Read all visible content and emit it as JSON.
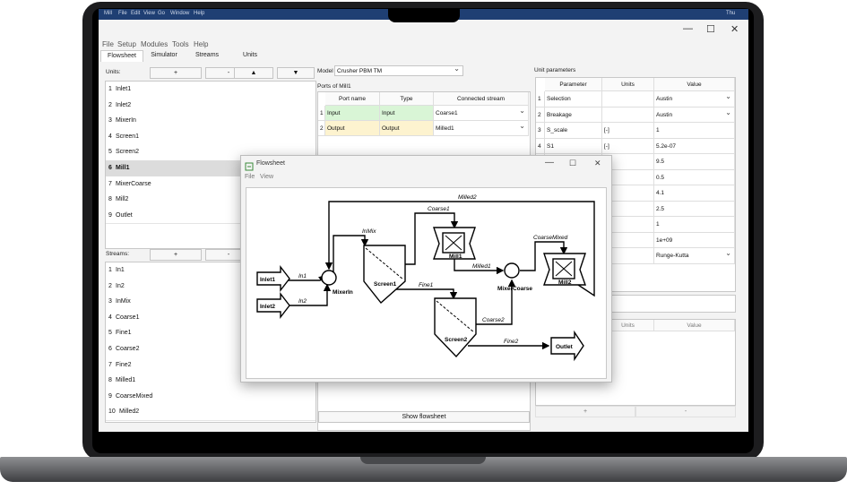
{
  "os_menubar": [
    "Mill",
    "File",
    "Edit",
    "View",
    "Go",
    "Window",
    "Help"
  ],
  "os_status": "Thu",
  "window_controls": {
    "minimize": "—",
    "maximize": "☐",
    "close": "✕"
  },
  "menu": [
    "File",
    "Setup",
    "Modules",
    "Tools",
    "Help"
  ],
  "tabs": [
    "Flowsheet",
    "Simulator",
    "Streams",
    "Units"
  ],
  "units_panel": {
    "label": "Units:",
    "buttons": [
      "+",
      "-",
      "▲",
      "▼"
    ],
    "items": [
      "Inlet1",
      "Inlet2",
      "MixerIn",
      "Screen1",
      "Screen2",
      "Mill1",
      "MixerCoarse",
      "Mill2",
      "Outlet"
    ],
    "selected": 5
  },
  "streams_panel": {
    "label": "Streams:",
    "buttons": [
      "+",
      "-"
    ],
    "items": [
      "In1",
      "In2",
      "InMix",
      "Coarse1",
      "Fine1",
      "Coarse2",
      "Fine2",
      "Milled1",
      "CoarseMixed",
      "Milled2"
    ]
  },
  "model": {
    "label": "Model",
    "value": "Crusher PBM TM"
  },
  "ports": {
    "title": "Ports of Mill1",
    "headers": [
      "Port name",
      "Type",
      "Connected stream"
    ],
    "rows": [
      {
        "n": "1",
        "name": "Input",
        "type": "Input",
        "stream": "Coarse1"
      },
      {
        "n": "2",
        "name": "Output",
        "type": "Output",
        "stream": "Milled1"
      }
    ]
  },
  "show_flowsheet": "Show flowsheet",
  "unit_params": {
    "title": "Unit parameters",
    "headers": [
      "Parameter",
      "Units",
      "Value"
    ],
    "rows": [
      {
        "n": "1",
        "p": "Selection",
        "u": "",
        "v": "Austin"
      },
      {
        "n": "2",
        "p": "Breakage",
        "u": "",
        "v": "Austin"
      },
      {
        "n": "3",
        "p": "S_scale",
        "u": "[-]",
        "v": "1"
      },
      {
        "n": "4",
        "p": "S1",
        "u": "[-]",
        "v": "5.2e-07"
      },
      {
        "v": "9.5"
      },
      {
        "v": "0.5"
      },
      {
        "v": "4.1"
      },
      {
        "v": "2.5"
      },
      {
        "v": "1"
      },
      {
        "v": "1e+09"
      },
      {
        "v": "Runge-Kutta"
      }
    ]
  },
  "lower_table": {
    "headers": [
      "Units",
      "Value"
    ],
    "buttons": [
      "+",
      "-"
    ]
  },
  "flowsheet_window": {
    "title": "Flowsheet",
    "menu": [
      "File",
      "View"
    ],
    "units": [
      "Inlet1",
      "Inlet2",
      "MixerIn",
      "Screen1",
      "Mill1",
      "MixerCoarse",
      "Mill2",
      "Screen2",
      "Outlet"
    ],
    "streams": [
      "In1",
      "In2",
      "InMix",
      "Coarse1",
      "Fine1",
      "Milled1",
      "CoarseMixed",
      "Milled2",
      "Coarse2",
      "Fine2"
    ]
  }
}
